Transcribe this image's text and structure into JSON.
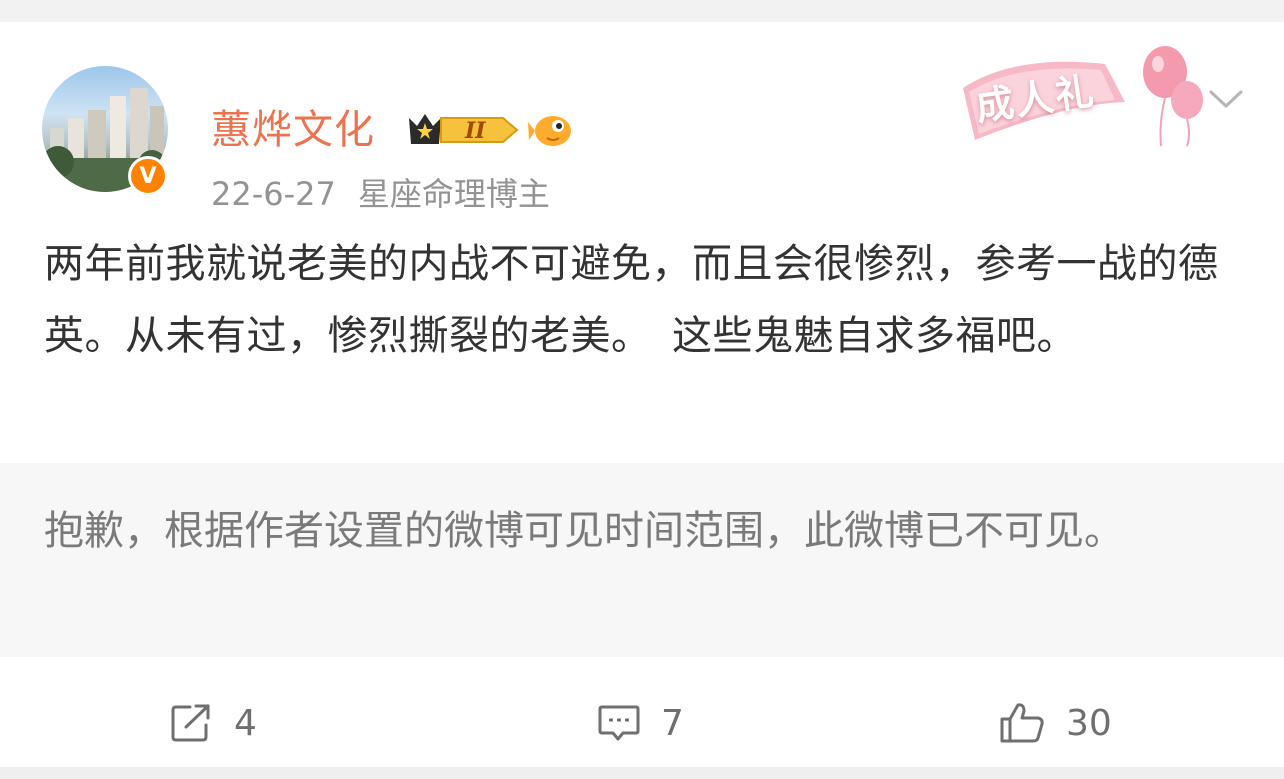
{
  "post": {
    "author": "蕙烨文化",
    "verified_mark": "V",
    "vip_level": "II",
    "timestamp": "22-6-27",
    "author_tag": "星座命理博主",
    "badge_text": "成人礼",
    "text": "两年前我就说老美的内战不可避免，而且会很惨烈，参考一战的德英。从未有过，惨烈撕裂的老美。　这些鬼魅自求多福吧。",
    "notice": "抱歉，根据作者设置的微博可见时间范围，此微博已不可见。"
  },
  "actions": {
    "repost_count": "4",
    "comment_count": "7",
    "like_count": "30"
  },
  "icons": {
    "repost": "repost-icon",
    "comment": "comment-icon",
    "like": "thumbs-up-icon",
    "more": "chevron-down-icon"
  },
  "colors": {
    "username": "#eb7350",
    "verified": "#ff8200",
    "meta": "#939393",
    "body_text": "#333333",
    "notice_bg": "#f7f7f7"
  }
}
